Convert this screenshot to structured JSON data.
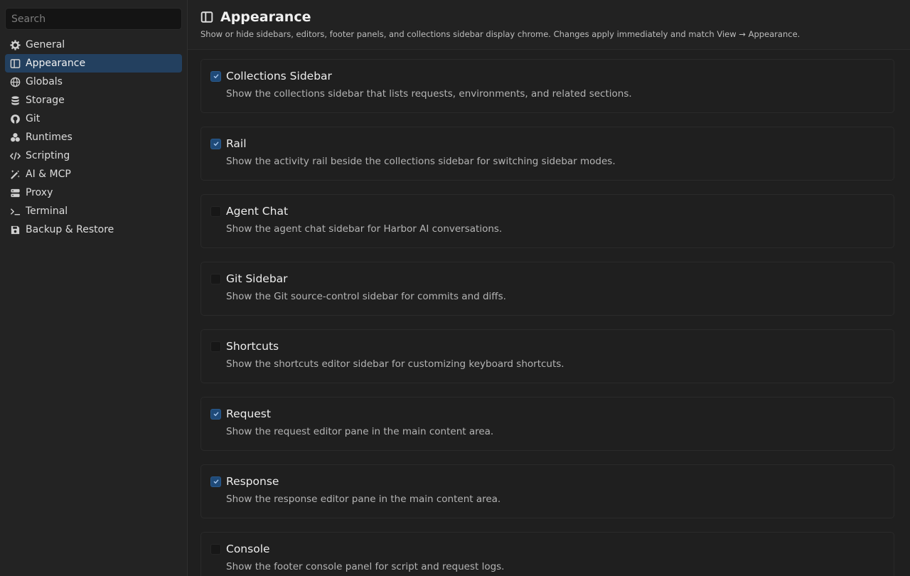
{
  "search": {
    "placeholder": "Search",
    "value": ""
  },
  "sidebar": {
    "items": [
      {
        "label": "General",
        "icon": "gear-icon",
        "active": false
      },
      {
        "label": "Appearance",
        "icon": "layout-icon",
        "active": true
      },
      {
        "label": "Globals",
        "icon": "globe-icon",
        "active": false
      },
      {
        "label": "Storage",
        "icon": "database-icon",
        "active": false
      },
      {
        "label": "Git",
        "icon": "github-icon",
        "active": false
      },
      {
        "label": "Runtimes",
        "icon": "cubes-icon",
        "active": false
      },
      {
        "label": "Scripting",
        "icon": "code-icon",
        "active": false
      },
      {
        "label": "AI & MCP",
        "icon": "magic-wand-icon",
        "active": false
      },
      {
        "label": "Proxy",
        "icon": "server-icon",
        "active": false
      },
      {
        "label": "Terminal",
        "icon": "terminal-icon",
        "active": false
      },
      {
        "label": "Backup & Restore",
        "icon": "save-icon",
        "active": false
      }
    ]
  },
  "header": {
    "title": "Appearance",
    "icon": "layout-icon",
    "subtitle": "Show or hide sidebars, editors, footer panels, and collections sidebar display chrome. Changes apply immediately and match View → Appearance."
  },
  "settings": [
    {
      "title": "Collections Sidebar",
      "description": "Show the collections sidebar that lists requests, environments, and related sections.",
      "checked": true
    },
    {
      "title": "Rail",
      "description": "Show the activity rail beside the collections sidebar for switching sidebar modes.",
      "checked": true
    },
    {
      "title": "Agent Chat",
      "description": "Show the agent chat sidebar for Harbor AI conversations.",
      "checked": false
    },
    {
      "title": "Git Sidebar",
      "description": "Show the Git source-control sidebar for commits and diffs.",
      "checked": false
    },
    {
      "title": "Shortcuts",
      "description": "Show the shortcuts editor sidebar for customizing keyboard shortcuts.",
      "checked": false
    },
    {
      "title": "Request",
      "description": "Show the request editor pane in the main content area.",
      "checked": true
    },
    {
      "title": "Response",
      "description": "Show the response editor pane in the main content area.",
      "checked": true
    },
    {
      "title": "Console",
      "description": "Show the footer console panel for script and request logs.",
      "checked": false
    }
  ],
  "colors": {
    "accent": "#23405f",
    "checkbox_checked": "#1f4a78",
    "background": "#1f1f1f"
  }
}
